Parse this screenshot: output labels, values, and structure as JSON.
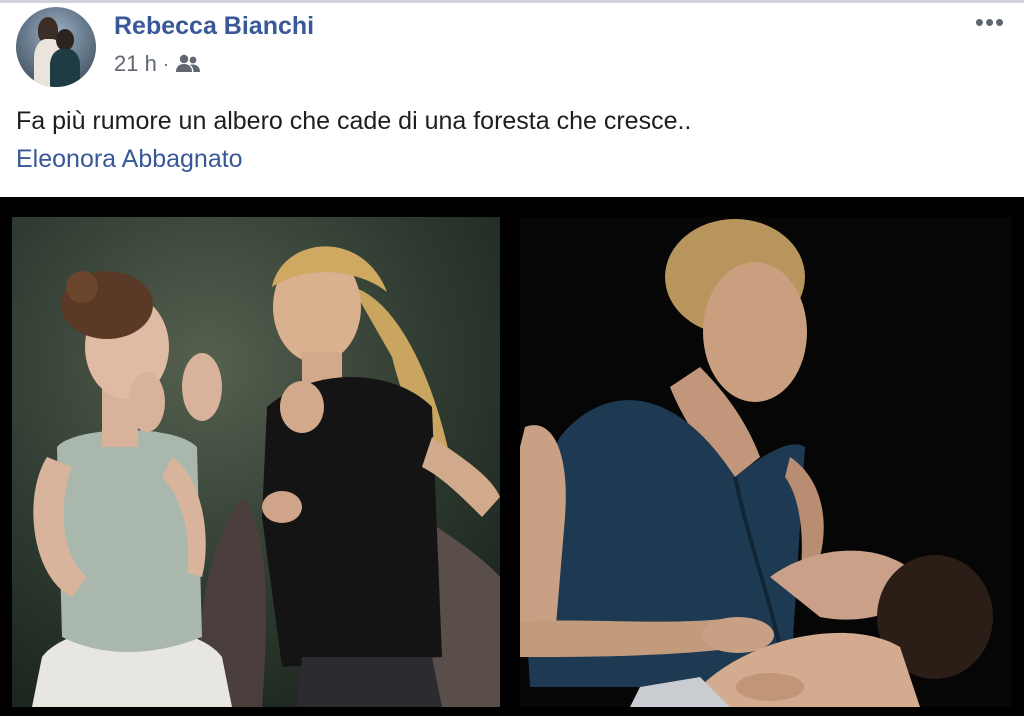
{
  "post": {
    "author_name": "Rebecca Bianchi",
    "timestamp": "21 h",
    "separator": "·",
    "audience_icon": "friends-icon",
    "more_icon": "more-options-icon",
    "more_label": "•••",
    "text": "Fa più rumore un albero che cade di una foresta che cresce..",
    "tagged_person": "Eleonora Abbagnato"
  },
  "colors": {
    "link_blue": "#385898",
    "meta_gray": "#606770",
    "text_dark": "#1c1e21"
  }
}
